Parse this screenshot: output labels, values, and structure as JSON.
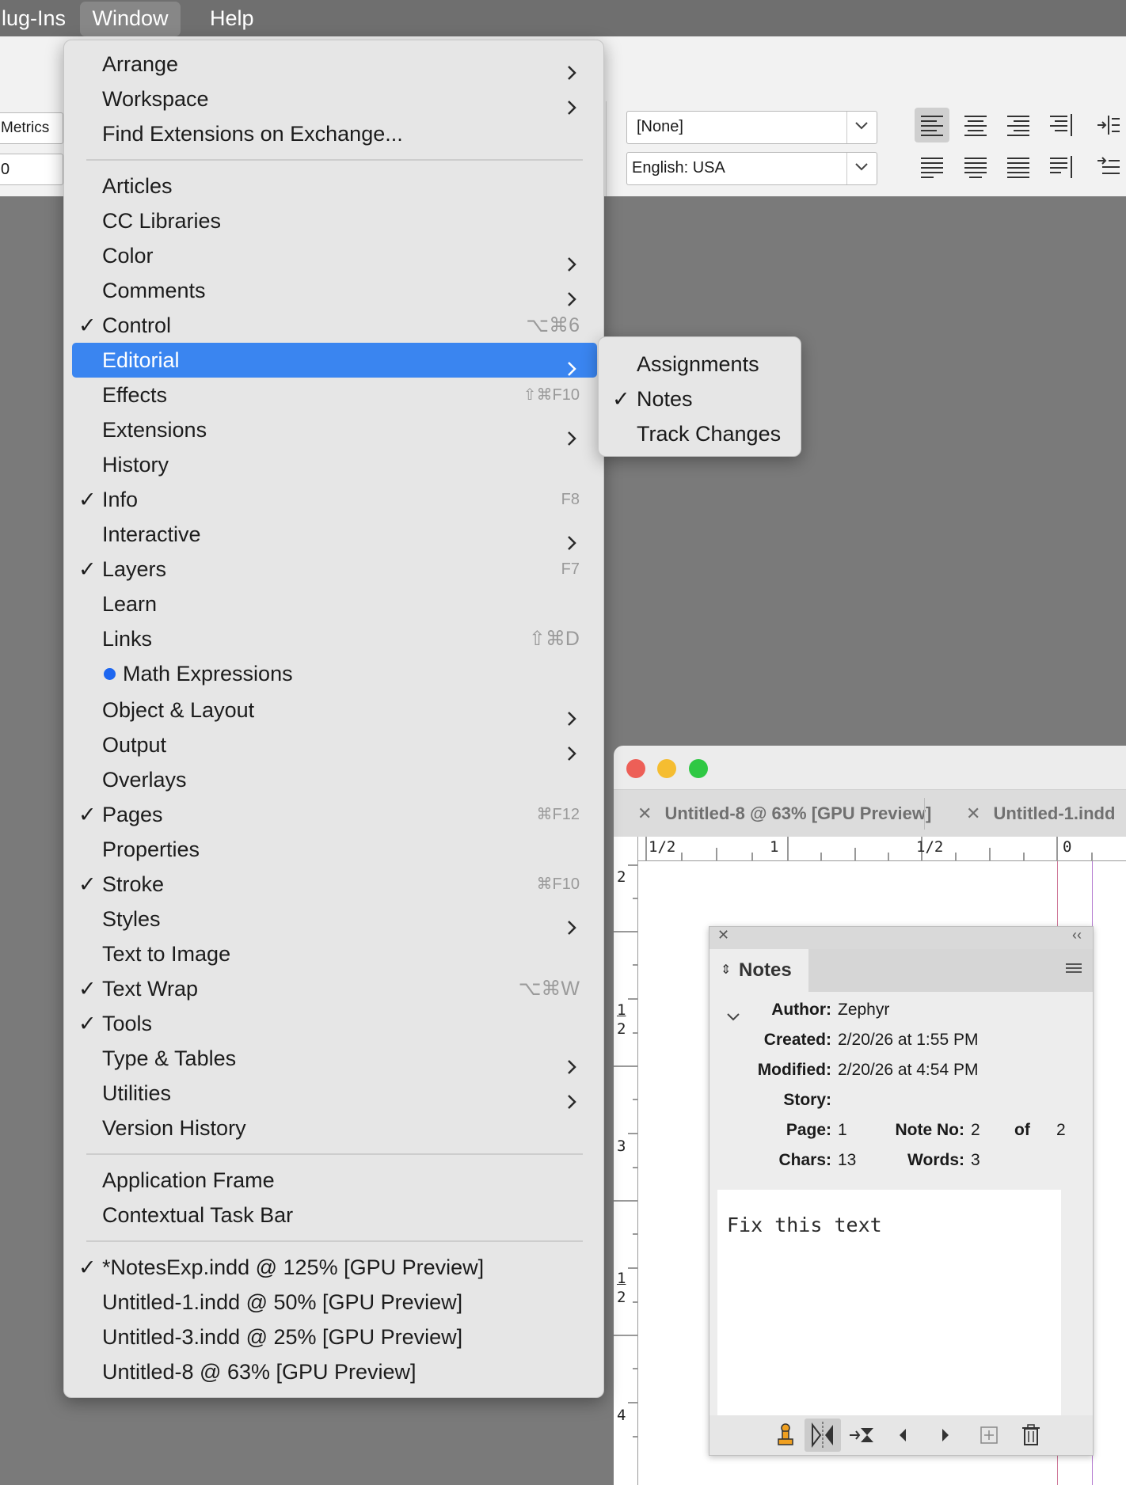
{
  "menubar": {
    "items": [
      "lug-Ins",
      "Window",
      "Help"
    ]
  },
  "control_panel": {
    "metrics_label": "Metrics",
    "tracking_value": "0",
    "char_style_value": "[None]",
    "language_value": "English: USA"
  },
  "window_menu": {
    "items": [
      {
        "label": "Arrange",
        "submenu": true
      },
      {
        "label": "Workspace",
        "submenu": true
      },
      {
        "label": "Find Extensions on Exchange..."
      },
      {
        "label": "Articles"
      },
      {
        "label": "CC Libraries"
      },
      {
        "label": "Color",
        "submenu": true
      },
      {
        "label": "Comments",
        "submenu": true
      },
      {
        "label": "Control",
        "checked": true,
        "shortcut": "⌥⌘6"
      },
      {
        "label": "Editorial",
        "submenu": true,
        "highlighted": true
      },
      {
        "label": "Effects",
        "shortcut": "⇧⌘F10"
      },
      {
        "label": "Extensions",
        "submenu": true
      },
      {
        "label": "History"
      },
      {
        "label": "Info",
        "checked": true,
        "shortcut": "F8"
      },
      {
        "label": "Interactive",
        "submenu": true
      },
      {
        "label": "Layers",
        "checked": true,
        "shortcut": "F7"
      },
      {
        "label": "Learn"
      },
      {
        "label": "Links",
        "shortcut": "⇧⌘D"
      },
      {
        "label": "Math Expressions",
        "badge": "new-dot"
      },
      {
        "label": "Object & Layout",
        "submenu": true
      },
      {
        "label": "Output",
        "submenu": true
      },
      {
        "label": "Overlays"
      },
      {
        "label": "Pages",
        "checked": true,
        "shortcut": "⌘F12"
      },
      {
        "label": "Properties"
      },
      {
        "label": "Stroke",
        "checked": true,
        "shortcut": "⌘F10"
      },
      {
        "label": "Styles",
        "submenu": true
      },
      {
        "label": "Text to Image"
      },
      {
        "label": "Text Wrap",
        "checked": true,
        "shortcut": "⌥⌘W"
      },
      {
        "label": "Tools",
        "checked": true
      },
      {
        "label": "Type & Tables",
        "submenu": true
      },
      {
        "label": "Utilities",
        "submenu": true
      },
      {
        "label": "Version History"
      },
      {
        "label": "Application Frame"
      },
      {
        "label": "Contextual Task Bar"
      },
      {
        "label": "*NotesExp.indd @ 125% [GPU Preview]",
        "checked": true
      },
      {
        "label": "Untitled-1.indd @ 50% [GPU Preview]"
      },
      {
        "label": "Untitled-3.indd @ 25% [GPU Preview]"
      },
      {
        "label": "Untitled-8 @ 63% [GPU Preview]"
      }
    ]
  },
  "editorial_submenu": {
    "items": [
      {
        "label": "Assignments"
      },
      {
        "label": "Notes",
        "checked": true
      },
      {
        "label": "Track Changes"
      }
    ]
  },
  "document": {
    "tabs": [
      "Untitled-8 @ 63% [GPU Preview]",
      "Untitled-1.indd"
    ],
    "ruler_top": [
      "1/2",
      "1",
      "1/2",
      "0"
    ],
    "ruler_left": [
      "2",
      "1",
      "2",
      "3",
      "1",
      "2",
      "4"
    ]
  },
  "notes_panel": {
    "tab_label": "Notes",
    "author_label": "Author:",
    "author": "Zephyr",
    "created_label": "Created:",
    "created": "2/20/26 at 1:55 PM",
    "modified_label": "Modified:",
    "modified": "2/20/26 at 4:54 PM",
    "story_label": "Story:",
    "page_label": "Page:",
    "page": "1",
    "note_no_label": "Note No:",
    "note_no": "2",
    "of_label": "of",
    "note_total": "2",
    "chars_label": "Chars:",
    "chars": "13",
    "words_label": "Words:",
    "words": "3",
    "note_text": "Fix this text"
  },
  "colors": {
    "menu_highlight": "#3a85f0",
    "new_dot": "#1d66f0",
    "traffic_close": "#ed5f57",
    "traffic_min": "#f5bd31",
    "traffic_max": "#2fc843"
  }
}
